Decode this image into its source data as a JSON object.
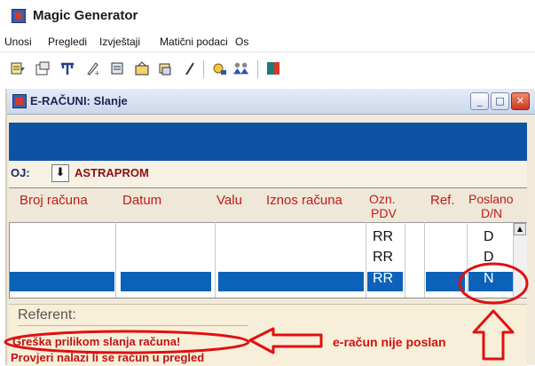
{
  "app": {
    "title": "Magic Generator",
    "icon": "app-logo-icon"
  },
  "menu": {
    "items": [
      "Unosi",
      "Pregledi",
      "Izvještaji",
      "Matični podaci",
      "Os"
    ]
  },
  "toolbar": {
    "buttons": [
      {
        "name": "tool-icon-1"
      },
      {
        "name": "tool-icon-2"
      },
      {
        "name": "tool-icon-3"
      },
      {
        "name": "tool-icon-4"
      },
      {
        "name": "tool-icon-5"
      },
      {
        "name": "tool-icon-6"
      },
      {
        "name": "tool-icon-7"
      },
      {
        "name": "tool-icon-8"
      },
      {
        "name": "tool-icon-9"
      },
      {
        "name": "tool-icon-10"
      },
      {
        "name": "tool-icon-11"
      }
    ]
  },
  "child_window": {
    "title": "E-RAČUNI: Slanje",
    "controls": {
      "minimize": "_",
      "maximize": "□",
      "close": "✕"
    }
  },
  "oj": {
    "label": "OJ:",
    "button_glyph": "⬇",
    "value": "ASTRAPROM"
  },
  "grid": {
    "columns": [
      {
        "key": "broj",
        "label": "Broj računa"
      },
      {
        "key": "datum",
        "label": "Datum"
      },
      {
        "key": "valu",
        "label": "Valu"
      },
      {
        "key": "iznos",
        "label": "Iznos računa"
      },
      {
        "key": "ozn",
        "label": "Ozn.",
        "label2": "PDV"
      },
      {
        "key": "ref",
        "label": "Ref."
      },
      {
        "key": "poslano",
        "label": "Poslano",
        "label2": "D/N"
      }
    ],
    "rows": [
      {
        "ozn": "RR",
        "poslano": "D",
        "selected": false
      },
      {
        "ozn": "RR",
        "poslano": "D",
        "selected": false
      },
      {
        "ozn": "RR",
        "poslano": "N",
        "selected": true
      }
    ],
    "scroll_up_glyph": "▲"
  },
  "referent": {
    "label": "Referent:"
  },
  "errors": {
    "line1": "Greška prilikom slanja računa!",
    "line2": "Provjeri nalazi li se račun u pregled"
  },
  "annotation": {
    "text": "e-račun nije poslan",
    "color": "#d80e0e"
  },
  "colors": {
    "selection": "#0c62b8",
    "band": "#0c54a3",
    "header_text": "#c21a1a",
    "error_text": "#c21212"
  }
}
